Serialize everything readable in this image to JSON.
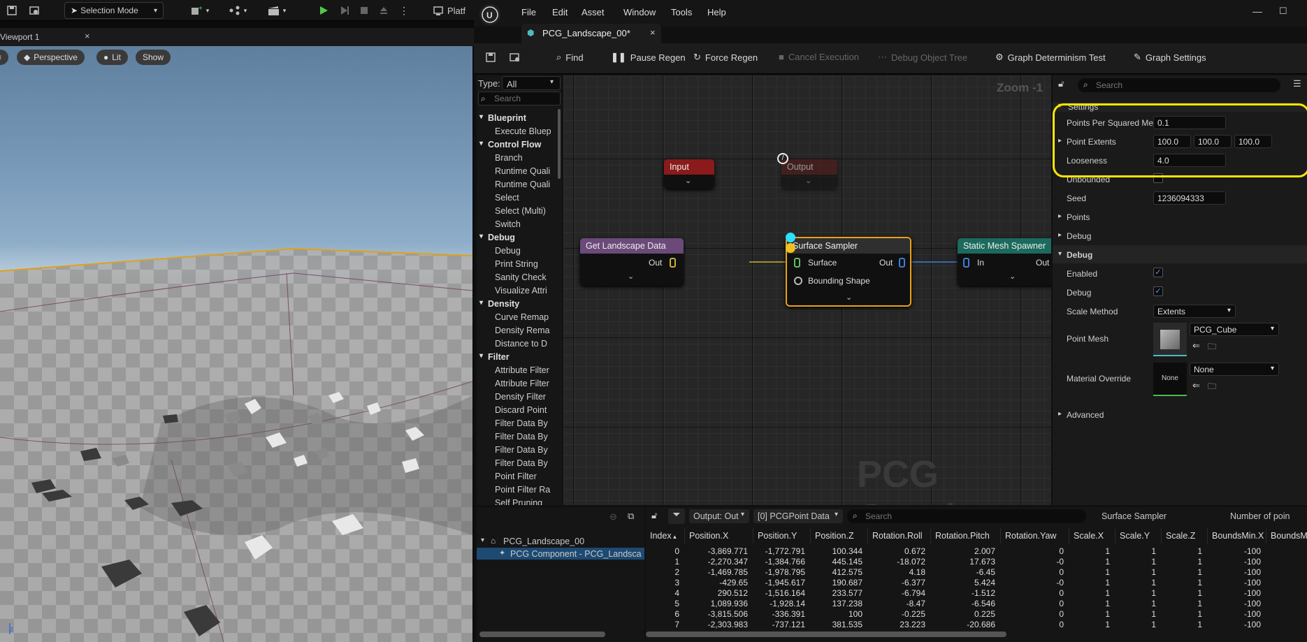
{
  "left_toolbar": {
    "selection_mode": "Selection Mode",
    "platform_partial": "Platf"
  },
  "viewport": {
    "tab_title": "Viewport 1",
    "perspective": "Perspective",
    "lit": "Lit",
    "show": "Show",
    "axis_z": "z"
  },
  "menu": [
    "File",
    "Edit",
    "Asset",
    "Window",
    "Tools",
    "Help"
  ],
  "doc_tab": {
    "title": "PCG_Landscape_00*"
  },
  "toolbar": {
    "find": "Find",
    "pause_regen": "Pause Regen",
    "force_regen": "Force Regen",
    "cancel_execution": "Cancel Execution",
    "debug_object_tree": "Debug Object Tree",
    "graph_determinism_test": "Graph Determinism Test",
    "graph_settings": "Graph Settings"
  },
  "palette": {
    "type_label": "Type:",
    "type_value": "All",
    "search_placeholder": "Search",
    "items": [
      {
        "label": "Blueprint",
        "cat": true
      },
      {
        "label": "Execute Bluep",
        "cat": false
      },
      {
        "label": "Control Flow",
        "cat": true
      },
      {
        "label": "Branch",
        "cat": false
      },
      {
        "label": "Runtime Quali",
        "cat": false
      },
      {
        "label": "Runtime Quali",
        "cat": false
      },
      {
        "label": "Select",
        "cat": false
      },
      {
        "label": "Select (Multi)",
        "cat": false
      },
      {
        "label": "Switch",
        "cat": false
      },
      {
        "label": "Debug",
        "cat": true
      },
      {
        "label": "Debug",
        "cat": false
      },
      {
        "label": "Print String",
        "cat": false
      },
      {
        "label": "Sanity Check",
        "cat": false
      },
      {
        "label": "Visualize Attri",
        "cat": false
      },
      {
        "label": "Density",
        "cat": true
      },
      {
        "label": "Curve Remap",
        "cat": false
      },
      {
        "label": "Density Rema",
        "cat": false
      },
      {
        "label": "Distance to D",
        "cat": false
      },
      {
        "label": "Filter",
        "cat": true
      },
      {
        "label": "Attribute Filter",
        "cat": false
      },
      {
        "label": "Attribute Filter",
        "cat": false
      },
      {
        "label": "Density Filter",
        "cat": false
      },
      {
        "label": "Discard Point",
        "cat": false
      },
      {
        "label": "Filter Data By",
        "cat": false
      },
      {
        "label": "Filter Data By",
        "cat": false
      },
      {
        "label": "Filter Data By",
        "cat": false
      },
      {
        "label": "Filter Data By",
        "cat": false
      },
      {
        "label": "Point Filter",
        "cat": false
      },
      {
        "label": "Point Filter Ra",
        "cat": false
      },
      {
        "label": "Self Pruning",
        "cat": false
      }
    ]
  },
  "graph": {
    "zoom": "Zoom -1",
    "watermark": "PCG Graph",
    "input_node": "Input",
    "output_node": "Output",
    "get_landscape": {
      "title": "Get Landscape Data",
      "out": "Out"
    },
    "surface_sampler": {
      "title": "Surface Sampler",
      "surface": "Surface",
      "bounding_shape": "Bounding Shape",
      "out": "Out"
    },
    "static_mesh_spawner": {
      "title": "Static Mesh Spawner",
      "in": "In",
      "out": "Out"
    },
    "colors": {
      "input": "#8b1a1a",
      "landscape": "#6b4a7a",
      "sampler": "#3a3a3a",
      "spawner": "#1c6a5e",
      "highlight": "#e8a21a"
    }
  },
  "details": {
    "search_placeholder": "Search",
    "settings_section": "Settings",
    "points_per_sq_meter_label": "Points Per Squared Meter",
    "points_per_sq_meter": "0.1",
    "point_extents_label": "Point Extents",
    "extent_x": "100.0",
    "extent_y": "100.0",
    "extent_z": "100.0",
    "looseness_label": "Looseness",
    "looseness": "4.0",
    "unbounded_label": "Unbounded",
    "seed_label": "Seed",
    "seed": "1236094333",
    "points_section": "Points",
    "debug_section_collapsed": "Debug",
    "debug_section": "Debug",
    "enabled_label": "Enabled",
    "debug_label": "Debug",
    "scale_method_label": "Scale Method",
    "scale_method": "Extents",
    "point_mesh_label": "Point Mesh",
    "point_mesh": "PCG_Cube",
    "material_override_label": "Material Override",
    "material_override": "None",
    "material_thumb": "None",
    "advanced_section": "Advanced",
    "highlight_color": "#ffe600"
  },
  "tree": {
    "root": "PCG_Landscape_00",
    "child": "PCG Component - PCG_Landsca"
  },
  "attributes": {
    "output_pin": "Output: Out",
    "data_index": "[0] PCGPoint Data",
    "search_placeholder": "Search",
    "node_name": "Surface Sampler",
    "num_points": "Number of poin",
    "columns": [
      "Index",
      "Position.X",
      "Position.Y",
      "Position.Z",
      "Rotation.Roll",
      "Rotation.Pitch",
      "Rotation.Yaw",
      "Scale.X",
      "Scale.Y",
      "Scale.Z",
      "BoundsMin.X",
      "BoundsM"
    ],
    "rows": [
      [
        "0",
        "-3,869.771",
        "-1,772.791",
        "100.344",
        "0.672",
        "2.007",
        "0",
        "1",
        "1",
        "1",
        "-100"
      ],
      [
        "1",
        "-2,270.347",
        "-1,384.766",
        "445.145",
        "-18.072",
        "17.673",
        "-0",
        "1",
        "1",
        "1",
        "-100"
      ],
      [
        "2",
        "-1,469.785",
        "-1,978.795",
        "412.575",
        "4.18",
        "-6.45",
        "0",
        "1",
        "1",
        "1",
        "-100"
      ],
      [
        "3",
        "-429.65",
        "-1,945.617",
        "190.687",
        "-6.377",
        "5.424",
        "-0",
        "1",
        "1",
        "1",
        "-100"
      ],
      [
        "4",
        "290.512",
        "-1,516.164",
        "233.577",
        "-6.794",
        "-1.512",
        "0",
        "1",
        "1",
        "1",
        "-100"
      ],
      [
        "5",
        "1,089.936",
        "-1,928.14",
        "137.238",
        "-8.47",
        "-6.546",
        "0",
        "1",
        "1",
        "1",
        "-100"
      ],
      [
        "6",
        "-3,815.506",
        "-336.391",
        "100",
        "-0.225",
        "0.225",
        "0",
        "1",
        "1",
        "1",
        "-100"
      ],
      [
        "7",
        "-2,303.983",
        "-737.121",
        "381.535",
        "23.223",
        "-20.686",
        "0",
        "1",
        "1",
        "1",
        "-100"
      ]
    ]
  }
}
